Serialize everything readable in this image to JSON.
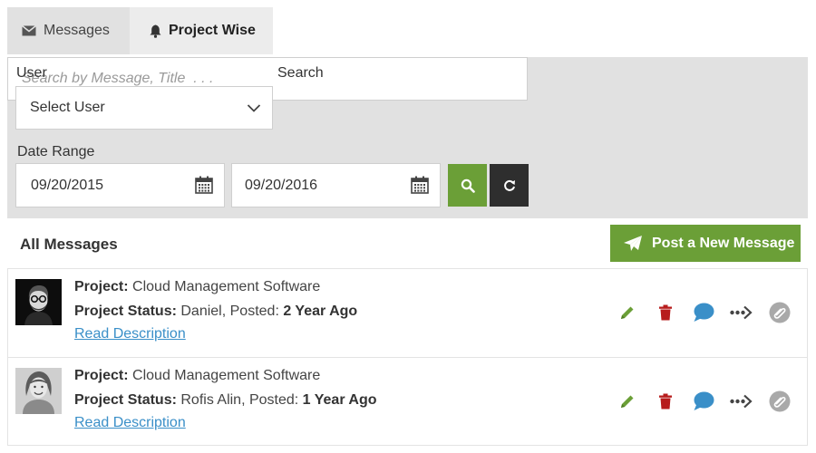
{
  "tabs": [
    {
      "label": "Messages",
      "icon": "envelope-icon"
    },
    {
      "label": "Project Wise",
      "icon": "bell-icon"
    }
  ],
  "filters": {
    "user_label": "User",
    "user_value": "Select User",
    "search_label": "Search",
    "search_placeholder": "Search by Message, Title  . . .",
    "date_label": "Date Range",
    "date_from": "09/20/2015",
    "date_to": "09/20/2016"
  },
  "list": {
    "title": "All Messages",
    "post_button": "Post a New Message"
  },
  "messages": [
    {
      "project_label": "Project:",
      "project": "Cloud Management Software",
      "status_label": "Project Status:",
      "status": "Daniel, Posted:",
      "posted": "2 Year Ago",
      "link": "Read Description"
    },
    {
      "project_label": "Project:",
      "project": "Cloud Management Software",
      "status_label": "Project Status:",
      "status": "Rofis Alin, Posted:",
      "posted": "1 Year Ago",
      "link": "Read Description"
    }
  ],
  "colors": {
    "accent_green": "#6b9f37",
    "dark_button": "#2e2e2e",
    "delete_red": "#b71c1c",
    "comment_blue": "#3a8fc8",
    "link_blue": "#3a8fc8",
    "panel_gray": "#e1e1e1"
  }
}
